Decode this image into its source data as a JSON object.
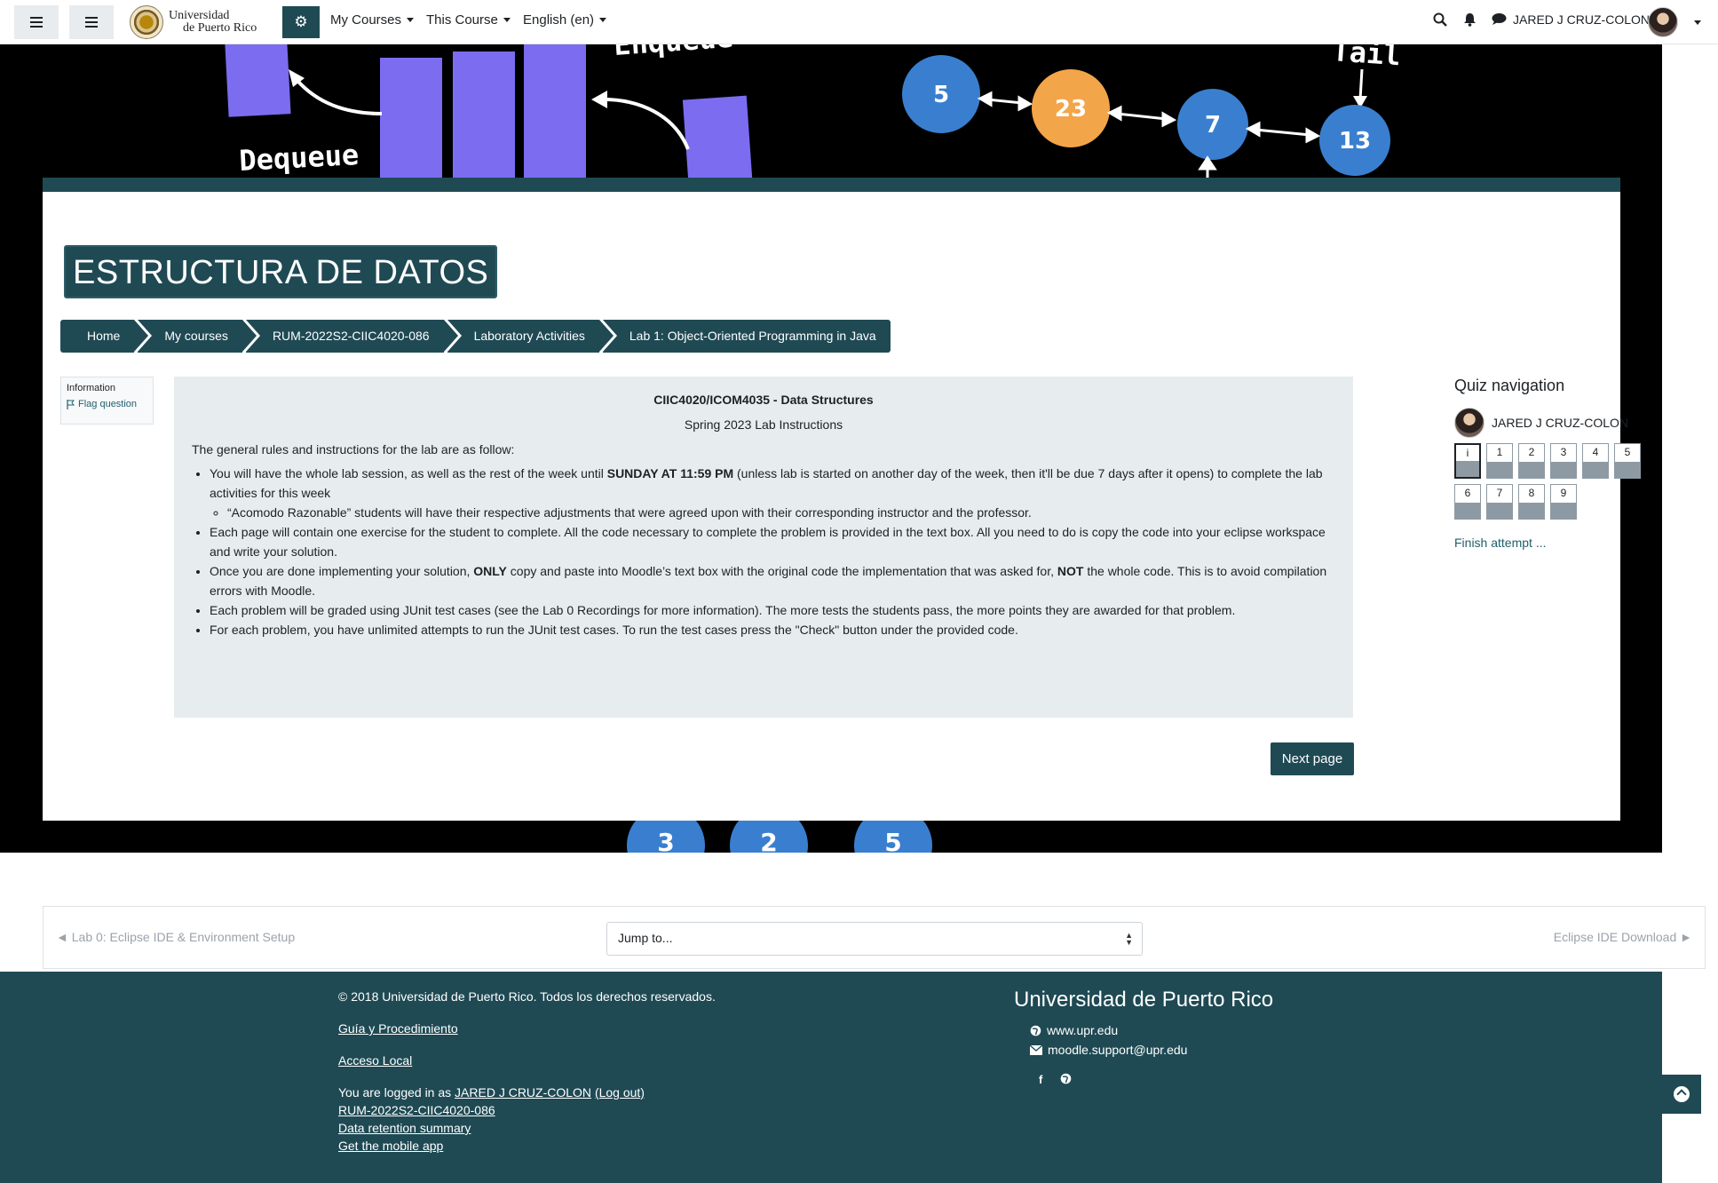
{
  "nav": {
    "my_courses": "My Courses",
    "this_course": "This Course",
    "language": "English (en)",
    "user_name": "JARED J CRUZ-COLON",
    "logo_line1": "Universidad",
    "logo_line2": "de Puerto Rico"
  },
  "hero": {
    "enqueue": "Enqueue",
    "dequeue": "Dequeue",
    "tail": "Tail",
    "node_values": [
      "5",
      "23",
      "7",
      "13"
    ],
    "bottom_values": [
      "3",
      "2",
      "5"
    ]
  },
  "course": {
    "title": "ESTRUCTURA DE DATOS"
  },
  "breadcrumb": [
    "Home",
    "My courses",
    "RUM-2022S2-CIIC4020-086",
    "Laboratory Activities",
    "Lab 1: Object-Oriented Programming in Java"
  ],
  "question_info": {
    "label": "Information",
    "flag": "Flag question"
  },
  "content": {
    "heading": "CIIC4020/ICOM4035 - Data Structures",
    "subheading": "Spring 2023 Lab Instructions",
    "intro": "The general rules and instructions for the lab are as follow:",
    "b1_pre": "You will have the whole lab session, as well as the rest of the week until ",
    "b1_bold": "SUNDAY AT 11:59 PM",
    "b1_post": " (unless lab is started on another day of the week, then it'll be due 7 days after it opens) to complete the lab activities for this week",
    "b1_sub": "“Acomodo Razonable” students will have their respective adjustments that were agreed upon with their corresponding instructor and the professor.",
    "b2": "Each page will contain one exercise for the student to complete. All the code necessary to complete the problem is provided in the text box. All you need to do is copy the code into your eclipse workspace and write your solution.",
    "b3_pre": "Once you are done implementing your solution, ",
    "b3_bold1": "ONLY",
    "b3_mid": " copy and paste into Moodle’s text box with the original code the implementation that was asked for, ",
    "b3_bold2": "NOT",
    "b3_post": " the whole code. This is to avoid compilation errors with Moodle.",
    "b4": "Each problem will be graded using JUnit test cases (see the Lab 0 Recordings for more information). The more tests the students pass, the more points they are awarded for that problem.",
    "b5": "For each problem, you have unlimited attempts to run the JUnit test cases. To run the test cases press the \"Check\" button under the provided code."
  },
  "next_page": "Next page",
  "quiz_nav": {
    "title": "Quiz navigation",
    "user": "JARED J CRUZ-COLON",
    "buttons": [
      "i",
      "1",
      "2",
      "3",
      "4",
      "5",
      "6",
      "7",
      "8",
      "9"
    ],
    "finish": "Finish attempt ..."
  },
  "activity_nav": {
    "prev": "◄ Lab 0: Eclipse IDE & Environment Setup",
    "jump": "Jump to...",
    "next": "Eclipse IDE Download ►"
  },
  "footer": {
    "copyright": "© 2018 Universidad de Puerto Rico. Todos los derechos reservados.",
    "guia": "Guía y Procedimiento",
    "acceso": "Acceso Local",
    "logged_pre": "You are logged in as ",
    "logged_user": "JARED J CRUZ-COLON",
    "logout": "(Log out)",
    "course_link": "RUM-2022S2-CIIC4020-086",
    "retention": "Data retention summary",
    "mobile": "Get the mobile app",
    "uni_title": "Universidad de Puerto Rico",
    "web": "www.upr.edu",
    "email": "moodle.support@upr.edu"
  },
  "colors": {
    "primary": "#1f4a54",
    "hero_bar": "#7b6cf0",
    "node_blue": "#3a7fcf",
    "node_orange": "#f3a54a"
  }
}
